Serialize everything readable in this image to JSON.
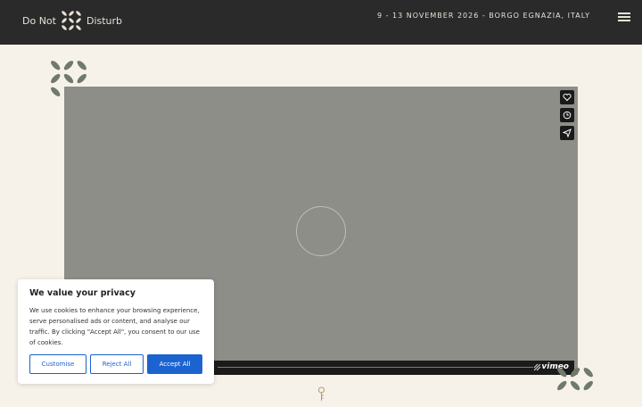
{
  "header": {
    "brand_left": "Do Not",
    "brand_right": "Disturb",
    "event_info": "9 - 13 NOVEMBER 2026 - BORGO EGNAZIA, ITALY",
    "menu_icon": "hamburger-menu-icon"
  },
  "video": {
    "state": "loading",
    "side_actions": [
      "like-icon",
      "watch-later-icon",
      "share-icon"
    ],
    "brand": "vimeo"
  },
  "cookie_banner": {
    "title": "We value your privacy",
    "body": "We use cookies to enhance your browsing experience, serve personalised ads or content, and analyse our traffic. By clicking \"Accept All\", you consent to our use of cookies.",
    "customise_label": "Customise",
    "reject_label": "Reject All",
    "accept_label": "Accept All"
  },
  "colors": {
    "header_bg": "#2a2a2a",
    "page_bg": "#f6f2ea",
    "accent": "#1c63d0",
    "deco": "#6f7a6a"
  }
}
